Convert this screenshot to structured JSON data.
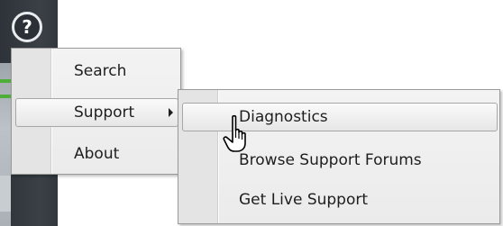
{
  "help_button": {
    "glyph": "?",
    "icon": "help-icon"
  },
  "main_menu": {
    "items": [
      {
        "label": "Search",
        "highlighted": false,
        "has_submenu": false
      },
      {
        "label": "Support",
        "highlighted": true,
        "has_submenu": true
      },
      {
        "label": "About",
        "highlighted": false,
        "has_submenu": false
      }
    ]
  },
  "support_submenu": {
    "items": [
      {
        "label": "Diagnostics",
        "highlighted": true
      },
      {
        "label": "Browse Support Forums",
        "highlighted": false
      },
      {
        "label": "Get Live Support",
        "highlighted": false
      }
    ]
  },
  "cursor": {
    "icon": "hand-pointer-icon"
  },
  "colors": {
    "app_strip": "#3a4046",
    "menu_background": "#efefef",
    "menu_border": "#9a9a9a",
    "highlight_border": "#a7a7a7",
    "text": "#1e1e1e",
    "status_green": "#4fae3a"
  }
}
